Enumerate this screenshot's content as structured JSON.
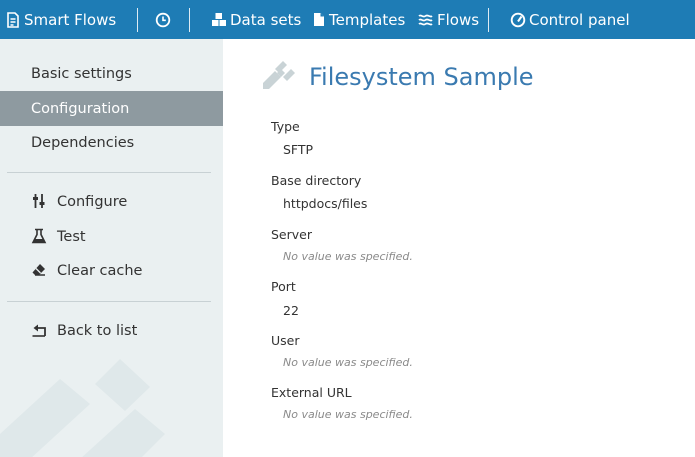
{
  "topbar": {
    "brand": "Smart Flows",
    "datasets": "Data sets",
    "templates": "Templates",
    "flows": "Flows",
    "control_panel": "Control panel",
    "color": "#1e7cb5"
  },
  "sidebar": {
    "tabs": [
      {
        "label": "Basic settings"
      },
      {
        "label": "Configuration",
        "active": true
      },
      {
        "label": "Dependencies"
      }
    ],
    "actions": [
      {
        "label": "Configure",
        "icon": "sliders-icon"
      },
      {
        "label": "Test",
        "icon": "flask-icon"
      },
      {
        "label": "Clear cache",
        "icon": "eraser-icon"
      }
    ],
    "back": {
      "label": "Back to list",
      "icon": "back-arrow-icon"
    }
  },
  "main": {
    "title": "Filesystem Sample",
    "title_icon": "plug-icon",
    "fields": [
      {
        "label": "Type",
        "value": "SFTP"
      },
      {
        "label": "Base directory",
        "value": "httpdocs/files"
      },
      {
        "label": "Server",
        "empty": "No value was specified."
      },
      {
        "label": "Port",
        "value": "22"
      },
      {
        "label": "User",
        "empty": "No value was specified."
      },
      {
        "label": "External URL",
        "empty": "No value was specified."
      }
    ]
  }
}
